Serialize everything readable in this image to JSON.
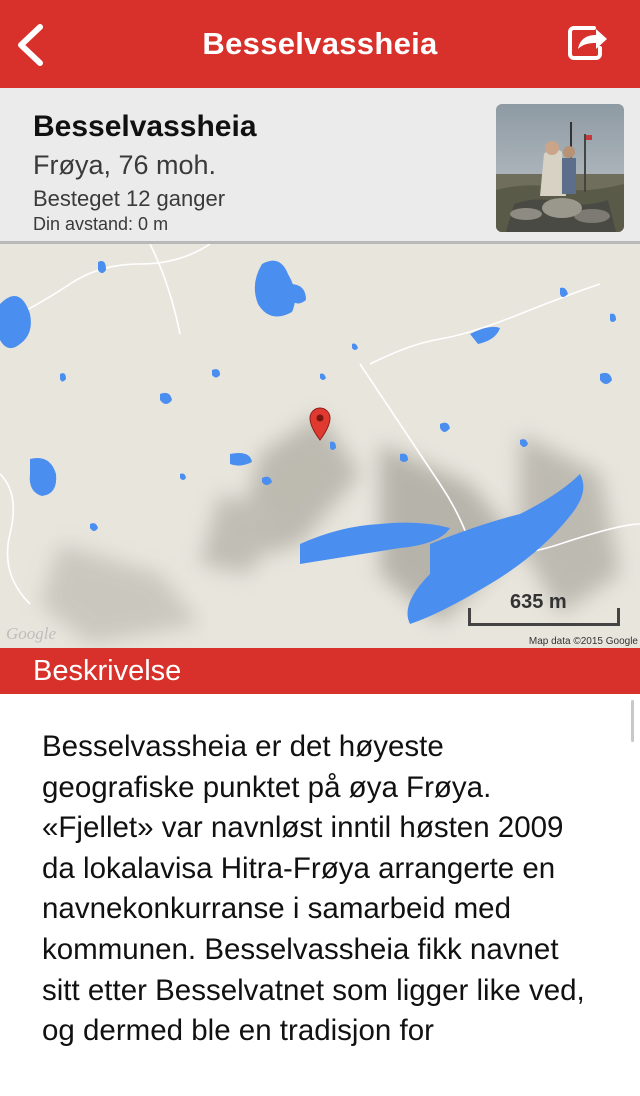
{
  "nav": {
    "title": "Besselvassheia",
    "back_icon": "chevron-left-icon",
    "share_icon": "share-icon",
    "bar_color": "#d8302a"
  },
  "peak": {
    "name": "Besselvassheia",
    "location": "Frøya, 76 moh.",
    "climbed": "Besteget 12 ganger",
    "distance": "Din avstand: 0 m"
  },
  "map": {
    "scale_label": "635 m",
    "logo": "Google",
    "credit": "Map data ©2015 Google",
    "marker_icon": "map-pin-icon",
    "water_color": "#4a8ff0"
  },
  "description": {
    "header": "Beskrivelse",
    "text": "Besselvassheia er det høyeste geografiske punktet på øya Frøya. «Fjellet» var navnløst inntil høsten 2009 da lokalavisa Hitra-Frøya arrangerte en navnekonkurranse i samarbeid med kommunen. Besselvassheia fikk navnet sitt etter Besselvatnet som ligger like ved, og dermed ble en tradisjon for"
  }
}
